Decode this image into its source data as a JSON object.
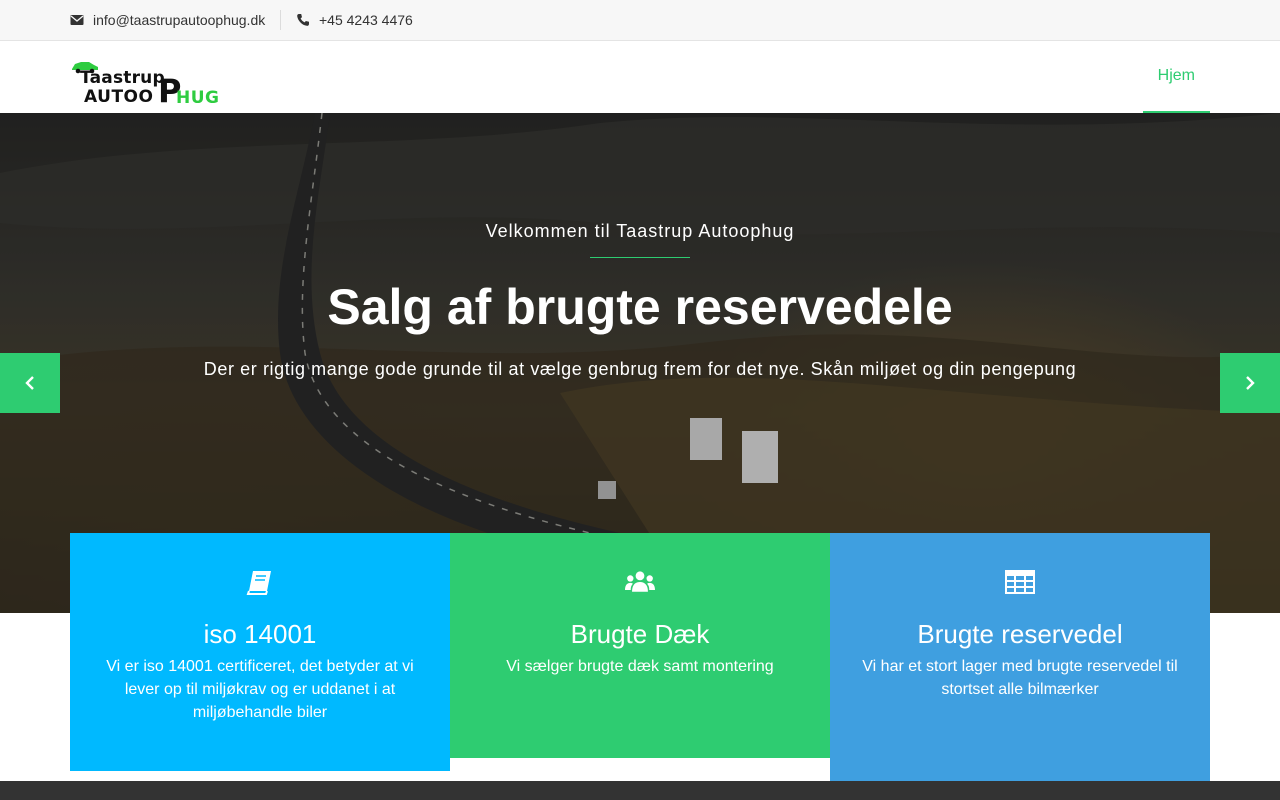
{
  "topbar": {
    "email": "info@taastrupautoophug.dk",
    "phone": "+45 4243 4476"
  },
  "logo": {
    "line1": "Taastrup",
    "line2": "AUTOO",
    "big_letter": "P",
    "line3": "HUG"
  },
  "nav": {
    "items": [
      {
        "label": "Hjem",
        "active": true
      }
    ]
  },
  "hero": {
    "kicker": "Velkommen til Taastrup Autoophug",
    "title": "Salg af brugte reservedele",
    "subtitle": "Der er rigtig mange gode grunde til at vælge genbrug frem for det nye. Skån miljøet og din pengepung"
  },
  "features": [
    {
      "icon": "book-icon",
      "title": "iso 14001",
      "text": "Vi er iso 14001 certificeret, det betyder at vi lever op til miljøkrav og er uddanet i at miljøbehandle biler",
      "color": "#00b9ff"
    },
    {
      "icon": "users-icon",
      "title": "Brugte Dæk",
      "text": "Vi sælger brugte dæk samt montering",
      "color": "#2ecc71"
    },
    {
      "icon": "table-icon",
      "title": "Brugte reservedel",
      "text": "Vi har et stort lager med brugte reservedel til stortset alle bilmærker",
      "color": "#3f9fe0"
    }
  ],
  "colors": {
    "accent": "#2ecc71",
    "topbar_bg": "#f7f7f7",
    "footer_bg": "#333333"
  }
}
